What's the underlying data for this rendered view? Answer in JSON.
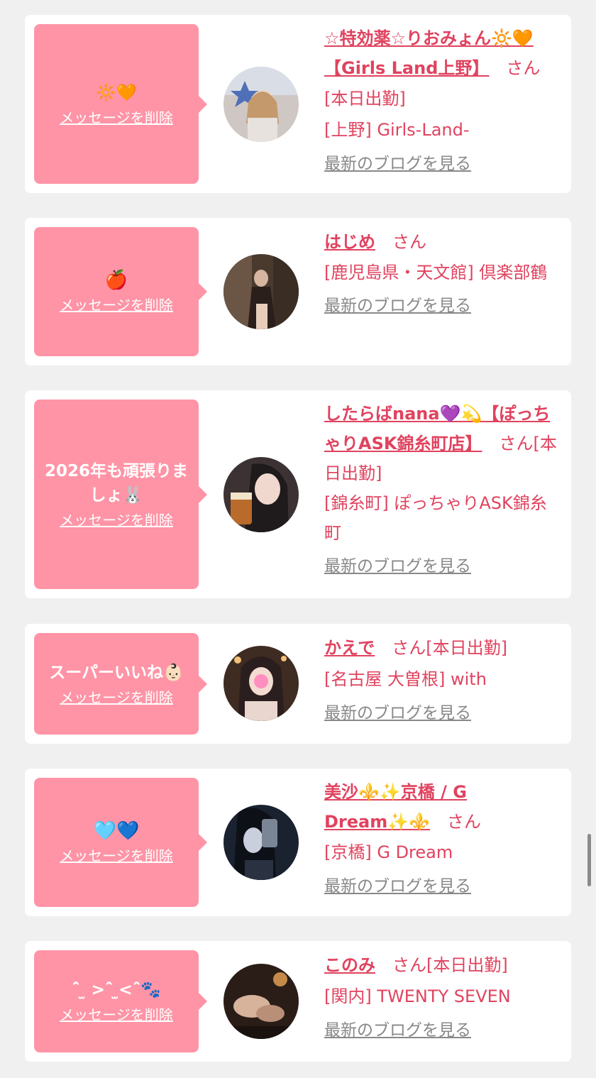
{
  "delete_label": "メッセージを削除",
  "honorific": "さん",
  "blog_label": "最新のブログを見る",
  "cards": [
    {
      "message": "🔆🧡",
      "name": "☆特効薬☆りおみょん🔆🧡【Girls Land上野】",
      "status": "[本日出勤]",
      "shop": "[上野] Girls-Land-"
    },
    {
      "message": "🍎",
      "name": "はじめ",
      "shop": "[鹿児島県・天文館] 倶楽部鶴"
    },
    {
      "message": "2026年も頑張りましょ🐰",
      "name": "したらばnana💜💫【ぽっちゃりASK錦糸町店】",
      "status": "[本日出勤]",
      "shop": "[錦糸町] ぽっちゃりASK錦糸町"
    },
    {
      "message": "スーパーいいね👶🏻",
      "name": "かえで",
      "status": "[本日出勤]",
      "shop": "[名古屋 大曽根] with"
    },
    {
      "message": "🩵💙",
      "name": "美沙⚜️✨京橋 / G Dream✨⚜️",
      "shop": "[京橋] G Dream"
    },
    {
      "message": "ˆ̑̑ ̫ >ˆ̑̑ ̫<ˆ̑̑🐾",
      "name": "このみ",
      "status": "[本日出勤]",
      "shop": "[関内] TWENTY SEVEN"
    }
  ],
  "colors": {
    "bubble": "#ff94a6",
    "accent": "#e0435f",
    "muted": "#888888",
    "background": "#f0f0f0"
  }
}
